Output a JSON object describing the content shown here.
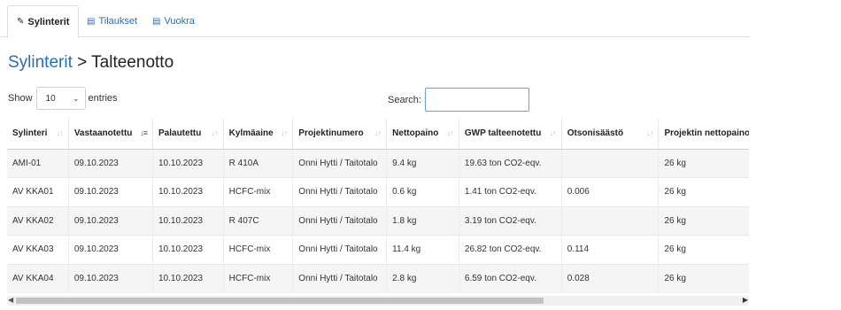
{
  "tabs": [
    {
      "label": "Sylinterit",
      "icon": "tag-icon",
      "active": true
    },
    {
      "label": "Tilaukset",
      "icon": "table-icon",
      "active": false
    },
    {
      "label": "Vuokra",
      "icon": "table-icon",
      "active": false
    }
  ],
  "breadcrumb": {
    "link": "Sylinterit",
    "separator": " > ",
    "current": "Talteenotto"
  },
  "length": {
    "show_label": "Show",
    "value": "10",
    "entries_label": "entries"
  },
  "search": {
    "label": "Search:",
    "value": ""
  },
  "table": {
    "columns": [
      "Sylinteri",
      "Vastaanotettu",
      "Palautettu",
      "Kylmäaine",
      "Projektinumero",
      "Nettopaino",
      "GWP talteenotettu",
      "Otsonisäästö",
      "Projektin nettopaino"
    ],
    "sorted_column_index": 1,
    "rows": [
      [
        "AMI-01",
        "09.10.2023",
        "10.10.2023",
        "R 410A",
        "Onni Hytti / Taitotalo",
        "9.4 kg",
        "19.63 ton CO2-eqv.",
        "",
        "26 kg"
      ],
      [
        "AV KKA01",
        "09.10.2023",
        "10.10.2023",
        "HCFC-mix",
        "Onni Hytti / Taitotalo",
        "0.6 kg",
        "1.41 ton CO2-eqv.",
        "0.006",
        "26 kg"
      ],
      [
        "AV KKA02",
        "09.10.2023",
        "10.10.2023",
        "R 407C",
        "Onni Hytti / Taitotalo",
        "1.8 kg",
        "3.19 ton CO2-eqv.",
        "",
        "26 kg"
      ],
      [
        "AV KKA03",
        "09.10.2023",
        "10.10.2023",
        "HCFC-mix",
        "Onni Hytti / Taitotalo",
        "11.4 kg",
        "26.82 ton CO2-eqv.",
        "0.114",
        "26 kg"
      ],
      [
        "AV KKA04",
        "09.10.2023",
        "10.10.2023",
        "HCFC-mix",
        "Onni Hytti / Taitotalo",
        "2.8 kg",
        "6.59 ton CO2-eqv.",
        "0.028",
        "26 kg"
      ]
    ]
  },
  "colors": {
    "link": "#2a6fad",
    "stripe": "#f5f5f5",
    "search_border": "#6aa0d4"
  }
}
